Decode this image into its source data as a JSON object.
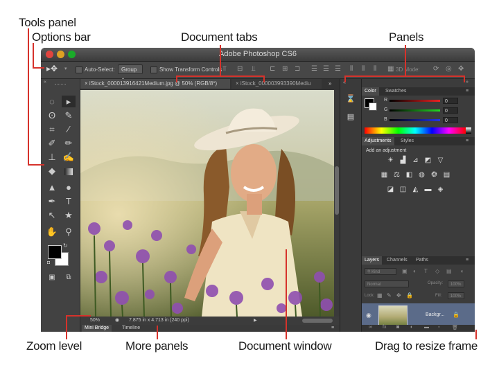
{
  "callouts": {
    "tools_panel": "Tools panel",
    "options_bar": "Options bar",
    "document_tabs": "Document tabs",
    "panels": "Panels",
    "zoom_level": "Zoom level",
    "more_panels": "More panels",
    "document_window": "Document window",
    "drag_to_resize": "Drag to resize frame"
  },
  "app": {
    "title": "Adobe Photoshop CS6"
  },
  "options_bar": {
    "auto_select_label": "Auto-Select:",
    "auto_select_value": "Group",
    "show_transform_label": "Show Transform Controls",
    "three_d_mode_label": "3D Mode:"
  },
  "document_tabs": [
    {
      "label": "iStock_000013916421Medium.jpg @ 50% (RGB/8*)",
      "close": "×",
      "active": true
    },
    {
      "label": "iStock_000003993390Mediu",
      "close": "×",
      "active": false
    }
  ],
  "status_bar": {
    "zoom": "50%",
    "doc_size": "7.875 in x 4.713 in (240 ppi)"
  },
  "bottom_tabs": [
    "Mini Bridge",
    "Timeline"
  ],
  "color_panel": {
    "tabs": [
      "Color",
      "Swatches"
    ],
    "channels": [
      {
        "label": "R",
        "value": "0"
      },
      {
        "label": "G",
        "value": "0"
      },
      {
        "label": "B",
        "value": "0"
      }
    ]
  },
  "adjustments_panel": {
    "tabs": [
      "Adjustments",
      "Styles"
    ],
    "heading": "Add an adjustment"
  },
  "layers_panel": {
    "tabs": [
      "Layers",
      "Channels",
      "Paths"
    ],
    "filter_label": "Kind",
    "blend_mode": "Normal",
    "opacity_label": "Opacity:",
    "opacity_value": "100%",
    "lock_label": "Lock:",
    "fill_label": "Fill:",
    "fill_value": "100%",
    "layer_name": "Backgr..."
  },
  "colors": {
    "accent": "#d6322b"
  }
}
